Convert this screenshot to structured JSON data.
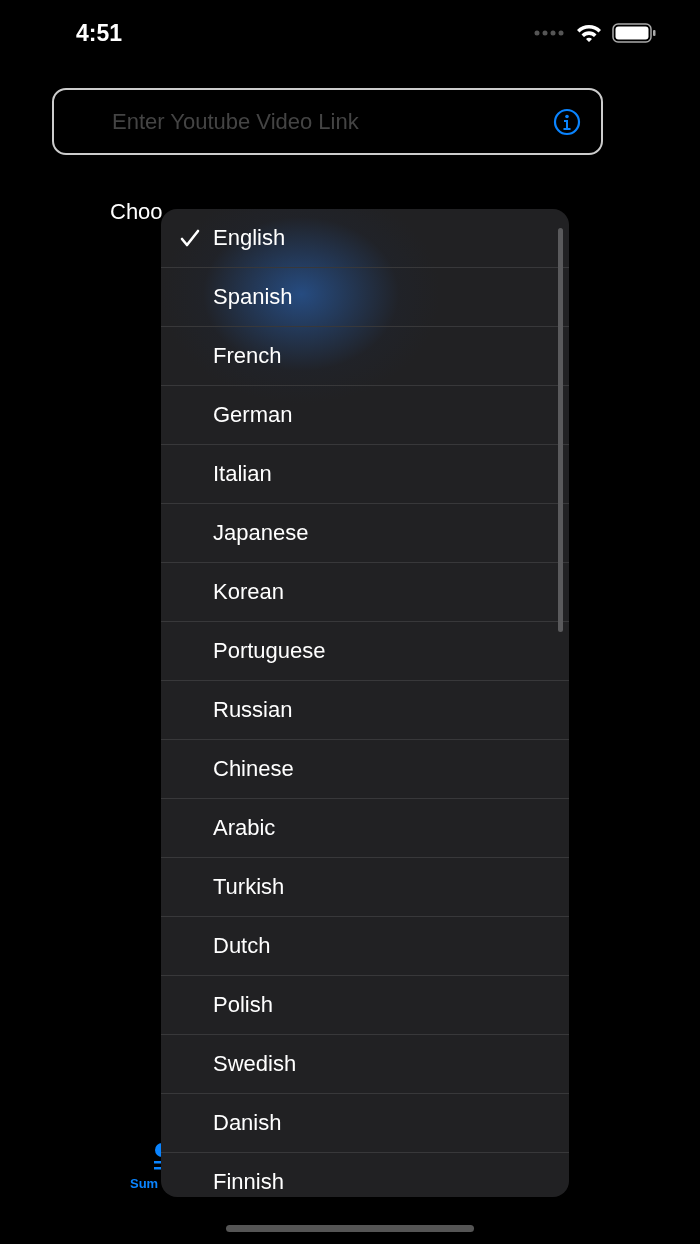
{
  "status_bar": {
    "time": "4:51"
  },
  "link_field": {
    "placeholder": "Enter Youtube Video Link"
  },
  "language_label": "Choo",
  "language_menu": [
    {
      "label": "English",
      "selected": true
    },
    {
      "label": "Spanish",
      "selected": false
    },
    {
      "label": "French",
      "selected": false
    },
    {
      "label": "German",
      "selected": false
    },
    {
      "label": "Italian",
      "selected": false
    },
    {
      "label": "Japanese",
      "selected": false
    },
    {
      "label": "Korean",
      "selected": false
    },
    {
      "label": "Portuguese",
      "selected": false
    },
    {
      "label": "Russian",
      "selected": false
    },
    {
      "label": "Chinese",
      "selected": false
    },
    {
      "label": "Arabic",
      "selected": false
    },
    {
      "label": "Turkish",
      "selected": false
    },
    {
      "label": "Dutch",
      "selected": false
    },
    {
      "label": "Polish",
      "selected": false
    },
    {
      "label": "Swedish",
      "selected": false
    },
    {
      "label": "Danish",
      "selected": false
    },
    {
      "label": "Finnish",
      "selected": false
    }
  ],
  "tab_bar": [
    {
      "label": "Sum",
      "selected": true
    }
  ]
}
